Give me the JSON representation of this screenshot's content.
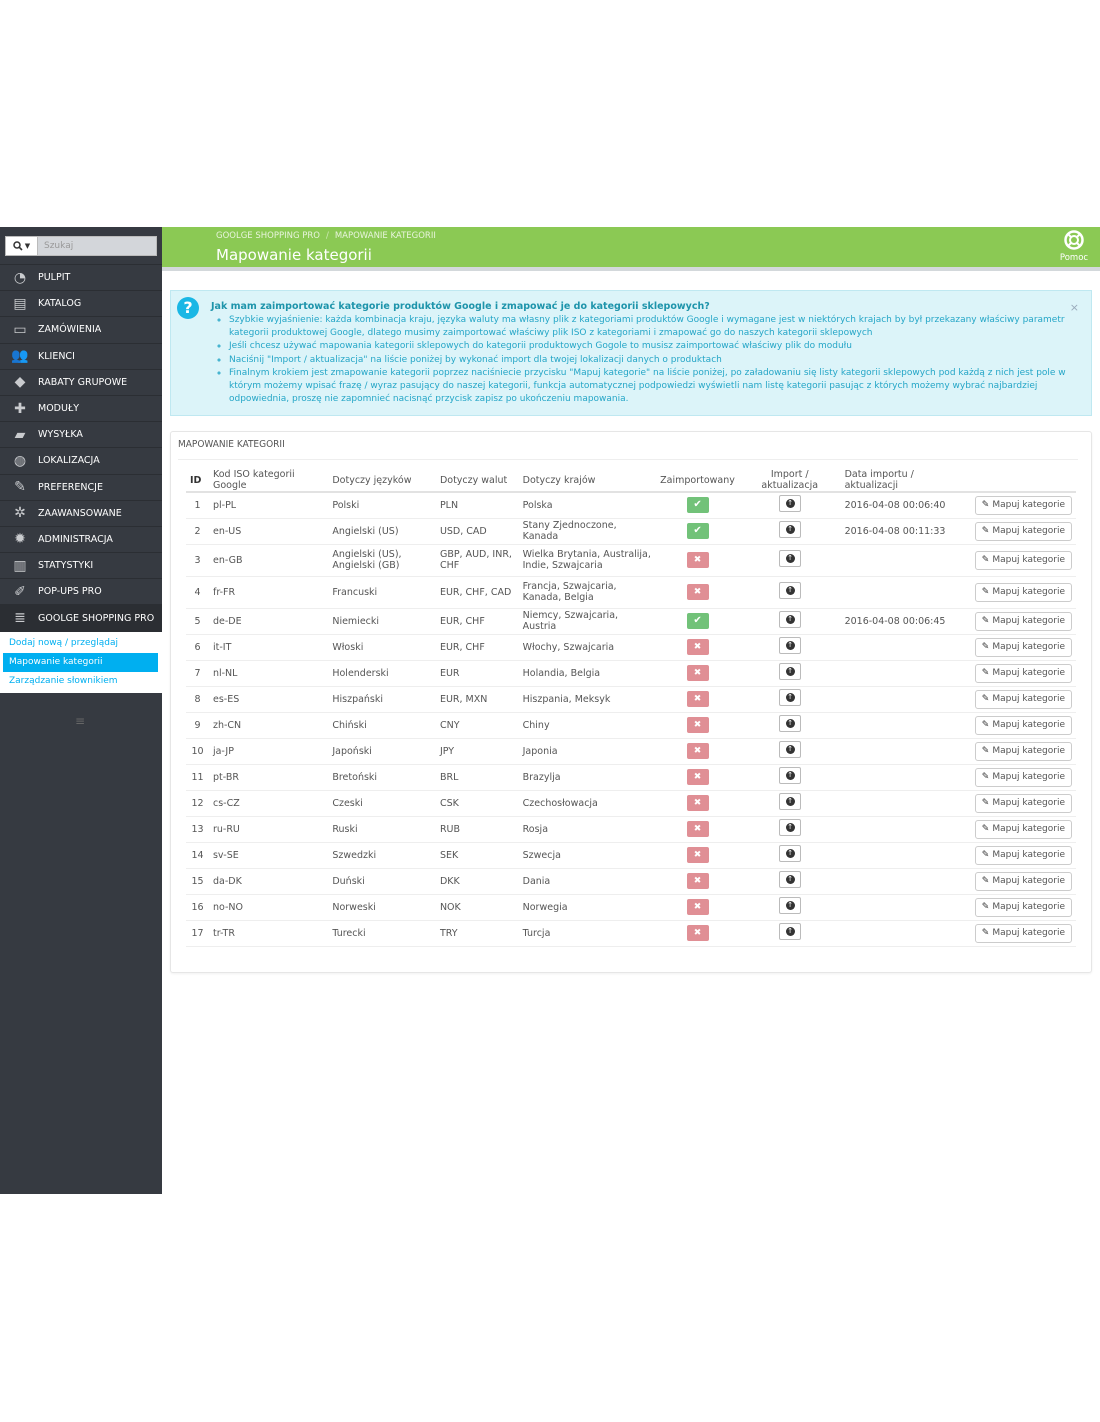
{
  "search": {
    "placeholder": "Szukaj"
  },
  "sidebar": {
    "items": [
      {
        "label": "PULPIT",
        "icon": "dashboard-icon"
      },
      {
        "label": "KATALOG",
        "icon": "catalog-icon"
      },
      {
        "label": "ZAMÓWIENIA",
        "icon": "credit-card-icon"
      },
      {
        "label": "KLIENCI",
        "icon": "users-icon"
      },
      {
        "label": "RABATY GRUPOWE",
        "icon": "tag-icon"
      },
      {
        "label": "MODUŁY",
        "icon": "puzzle-icon"
      },
      {
        "label": "WYSYŁKA",
        "icon": "truck-icon"
      },
      {
        "label": "LOKALIZACJA",
        "icon": "globe-icon"
      },
      {
        "label": "PREFERENCJE",
        "icon": "wrench-icon"
      },
      {
        "label": "ZAAWANSOWANE",
        "icon": "cogs-icon"
      },
      {
        "label": "ADMINISTRACJA",
        "icon": "cog-icon"
      },
      {
        "label": "STATYSTYKI",
        "icon": "bar-chart-icon"
      },
      {
        "label": "POP-UPS PRO",
        "icon": "edit-icon"
      },
      {
        "label": "GOOLGE SHOPPING PRO",
        "icon": "database-icon"
      }
    ],
    "submenu": [
      {
        "label": "Dodaj nową / przeglądaj"
      },
      {
        "label": "Mapowanie kategorii"
      },
      {
        "label": "Zarządzanie słownikiem"
      }
    ]
  },
  "header": {
    "breadcrumb": [
      "GOOLGE SHOPPING PRO",
      "MAPOWANIE KATEGORII"
    ],
    "title": "Mapowanie kategorii",
    "help_label": "Pomoc"
  },
  "info": {
    "title": "Jak mam zaimportować kategorie produktów Google i zmapować je do kategorii sklepowych?",
    "close": "×",
    "items": [
      "Szybkie wyjaśnienie: każda kombinacja kraju, języka waluty ma własny plik z kategoriami produktów Google i wymagane jest w niektórych krajach by był przekazany właściwy parametr kategorii produktowej Google, dlatego musimy zaimportować właściwy plik ISO z kategoriami i zmapować go do naszych kategorii sklepowych",
      "Jeśli chcesz używać mapowania kategorii sklepowych do kategorii produktowych Gogole to musisz zaimportować właściwy plik do modułu",
      "Naciśnij \"Import / aktualizacja\" na liście poniżej by wykonać import dla twojej lokalizacji danych o produktach",
      "Finalnym krokiem jest zmapowanie kategorii poprzez naciśniecie przycisku \"Mapuj kategorie\" na liście poniżej, po załadowaniu się listy kategorii sklepowych pod każdą z nich jest pole w którym możemy wpisać frazę / wyraz pasujący do naszej kategorii, funkcja automatycznej podpowiedzi wyświetli nam listę kategorii pasując z których możemy wybrać najbardziej odpowiednia, proszę nie zapomnieć nacisnąć przycisk zapisz po ukończeniu mapowania."
    ]
  },
  "panel": {
    "heading": "MAPOWANIE KATEGORII",
    "columns": [
      "ID",
      "Kod ISO kategorii Google",
      "Dotyczy języków",
      "Dotyczy walut",
      "Dotyczy krajów",
      "Zaimportowany",
      "Import / aktualizacja",
      "Data importu / aktualizacji",
      ""
    ],
    "map_label": "Mapuj kategorie",
    "rows": [
      {
        "id": "1",
        "iso": "pl-PL",
        "lang": "Polski",
        "cur": "PLN",
        "country": "Polska",
        "imported": true,
        "date": "2016-04-08 00:06:40"
      },
      {
        "id": "2",
        "iso": "en-US",
        "lang": "Angielski (US)",
        "cur": "USD, CAD",
        "country": "Stany Zjednoczone, Kanada",
        "imported": true,
        "date": "2016-04-08 00:11:33"
      },
      {
        "id": "3",
        "iso": "en-GB",
        "lang": "Angielski (US), Angielski (GB)",
        "cur": "GBP, AUD, INR, CHF",
        "country": "Wielka Brytania, Australija, Indie, Szwajcaria",
        "imported": false,
        "date": ""
      },
      {
        "id": "4",
        "iso": "fr-FR",
        "lang": "Francuski",
        "cur": "EUR, CHF, CAD",
        "country": "Francja, Szwajcaria, Kanada, Belgia",
        "imported": false,
        "date": ""
      },
      {
        "id": "5",
        "iso": "de-DE",
        "lang": "Niemiecki",
        "cur": "EUR, CHF",
        "country": "Niemcy, Szwajcaria, Austria",
        "imported": true,
        "date": "2016-04-08 00:06:45"
      },
      {
        "id": "6",
        "iso": "it-IT",
        "lang": "Włoski",
        "cur": "EUR, CHF",
        "country": "Włochy, Szwajcaria",
        "imported": false,
        "date": ""
      },
      {
        "id": "7",
        "iso": "nl-NL",
        "lang": "Holenderski",
        "cur": "EUR",
        "country": "Holandia, Belgia",
        "imported": false,
        "date": ""
      },
      {
        "id": "8",
        "iso": "es-ES",
        "lang": "Hiszpański",
        "cur": "EUR, MXN",
        "country": "Hiszpania, Meksyk",
        "imported": false,
        "date": ""
      },
      {
        "id": "9",
        "iso": "zh-CN",
        "lang": "Chiński",
        "cur": "CNY",
        "country": "Chiny",
        "imported": false,
        "date": ""
      },
      {
        "id": "10",
        "iso": "ja-JP",
        "lang": "Japoński",
        "cur": "JPY",
        "country": "Japonia",
        "imported": false,
        "date": ""
      },
      {
        "id": "11",
        "iso": "pt-BR",
        "lang": "Bretoński",
        "cur": "BRL",
        "country": "Brazylja",
        "imported": false,
        "date": ""
      },
      {
        "id": "12",
        "iso": "cs-CZ",
        "lang": "Czeski",
        "cur": "CSK",
        "country": "Czechosłowacja",
        "imported": false,
        "date": ""
      },
      {
        "id": "13",
        "iso": "ru-RU",
        "lang": "Ruski",
        "cur": "RUB",
        "country": "Rosja",
        "imported": false,
        "date": ""
      },
      {
        "id": "14",
        "iso": "sv-SE",
        "lang": "Szwedzki",
        "cur": "SEK",
        "country": "Szwecja",
        "imported": false,
        "date": ""
      },
      {
        "id": "15",
        "iso": "da-DK",
        "lang": "Duński",
        "cur": "DKK",
        "country": "Dania",
        "imported": false,
        "date": ""
      },
      {
        "id": "16",
        "iso": "no-NO",
        "lang": "Norweski",
        "cur": "NOK",
        "country": "Norwegia",
        "imported": false,
        "date": ""
      },
      {
        "id": "17",
        "iso": "tr-TR",
        "lang": "Turecki",
        "cur": "TRY",
        "country": "Turcja",
        "imported": false,
        "date": ""
      }
    ]
  },
  "colors": {
    "header": "#8bc954",
    "sidebar": "#363a41",
    "accent": "#00aff0",
    "ok": "#72c279",
    "no": "#e08f95"
  }
}
